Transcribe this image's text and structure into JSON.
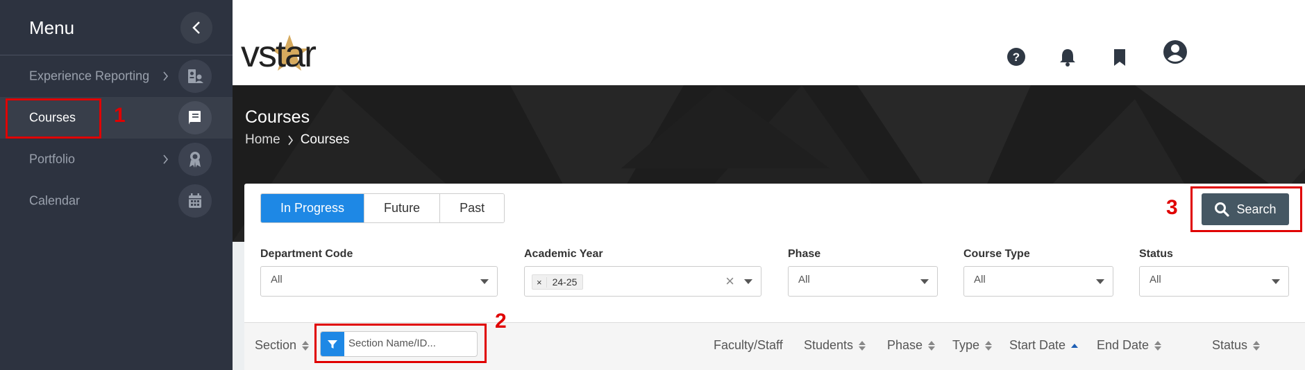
{
  "sidebar": {
    "title": "Menu",
    "items": [
      {
        "label": "Experience Reporting",
        "icon": "id-badge-icon"
      },
      {
        "label": "Courses",
        "icon": "book-icon"
      },
      {
        "label": "Portfolio",
        "icon": "award-icon"
      },
      {
        "label": "Calendar",
        "icon": "calendar-icon"
      }
    ]
  },
  "header": {
    "logo": "vstar",
    "icons": [
      "help-icon",
      "bell-icon",
      "bookmark-icon",
      "account-icon"
    ]
  },
  "hero": {
    "title": "Courses",
    "breadcrumb": {
      "home": "Home",
      "current": "Courses"
    }
  },
  "tabs": [
    {
      "label": "In Progress",
      "active": true
    },
    {
      "label": "Future",
      "active": false
    },
    {
      "label": "Past",
      "active": false
    }
  ],
  "search_button": "Search",
  "filters": {
    "department": {
      "label": "Department Code",
      "value": "All"
    },
    "academic_year": {
      "label": "Academic Year",
      "chip": "24-25",
      "chip_remove": "×",
      "clear": "×"
    },
    "phase": {
      "label": "Phase",
      "value": "All"
    },
    "course_type": {
      "label": "Course Type",
      "value": "All"
    },
    "status": {
      "label": "Status",
      "value": "All"
    }
  },
  "table": {
    "section": "Section",
    "section_filter_placeholder": "Section Name/ID...",
    "columns": [
      "Faculty/Staff",
      "Students",
      "Phase",
      "Type",
      "Start Date",
      "End Date",
      "Status"
    ]
  },
  "annotations": [
    "1",
    "2",
    "3"
  ],
  "colors": {
    "sidebar": "#2d3340",
    "accent": "#1e88e5",
    "search_button": "#455763",
    "annotation": "#e00000"
  }
}
